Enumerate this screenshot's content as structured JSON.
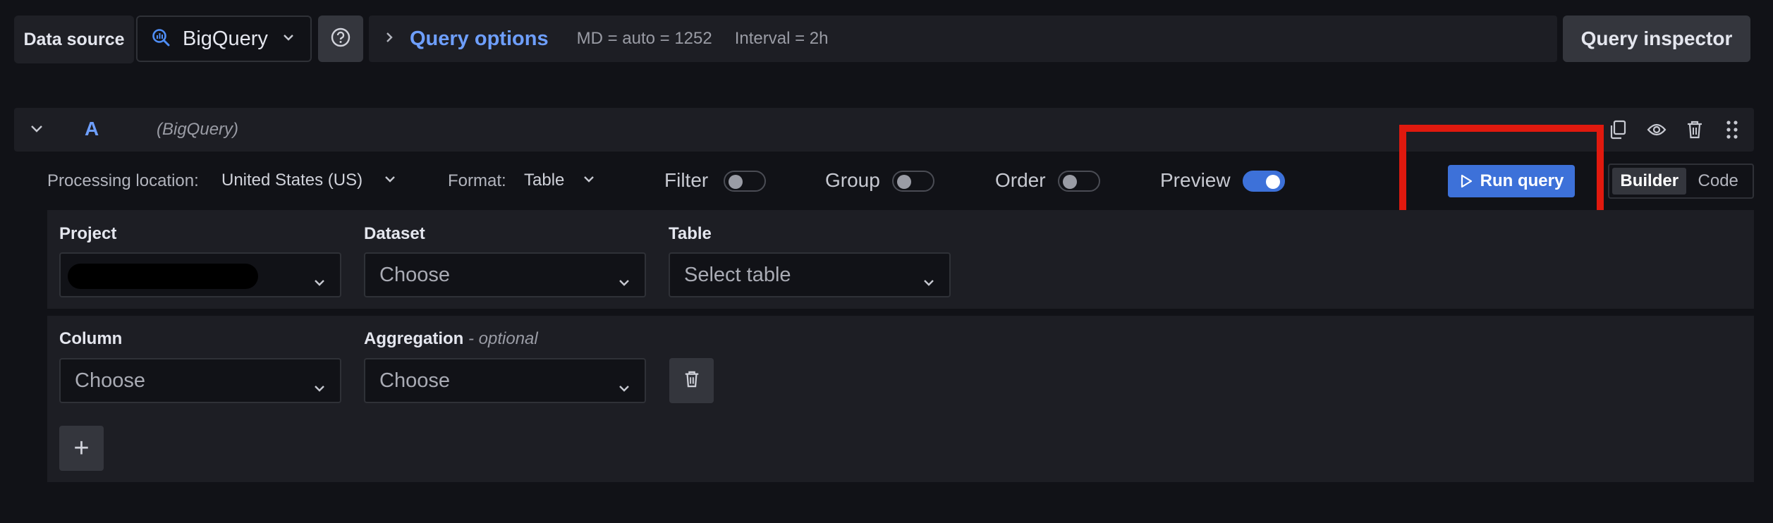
{
  "toolbar": {
    "data_source_label": "Data source",
    "data_source_value": "BigQuery",
    "query_options_label": "Query options",
    "max_data_points": "MD = auto = 1252",
    "interval": "Interval = 2h",
    "query_inspector_label": "Query inspector"
  },
  "query": {
    "ref_id": "A",
    "datasource": "(BigQuery)"
  },
  "options": {
    "processing_location_label": "Processing location:",
    "processing_location_value": "United States (US)",
    "format_label": "Format:",
    "format_value": "Table",
    "filter_label": "Filter",
    "filter_on": false,
    "group_label": "Group",
    "group_on": false,
    "order_label": "Order",
    "order_on": false,
    "preview_label": "Preview",
    "preview_on": true,
    "run_query_label": "Run query",
    "mode_builder": "Builder",
    "mode_code": "Code",
    "active_mode": "Builder"
  },
  "builder": {
    "project_label": "Project",
    "project_value": "",
    "dataset_label": "Dataset",
    "dataset_placeholder": "Choose",
    "table_label": "Table",
    "table_placeholder": "Select table",
    "column_label": "Column",
    "column_placeholder": "Choose",
    "aggregation_label": "Aggregation",
    "aggregation_optional": "- optional",
    "aggregation_placeholder": "Choose",
    "add_label": "+"
  },
  "colors": {
    "background": "#111217",
    "panel": "#1d1e24",
    "accent": "#3d71d9",
    "link": "#6e9fff",
    "highlight_box": "#e0190e"
  }
}
